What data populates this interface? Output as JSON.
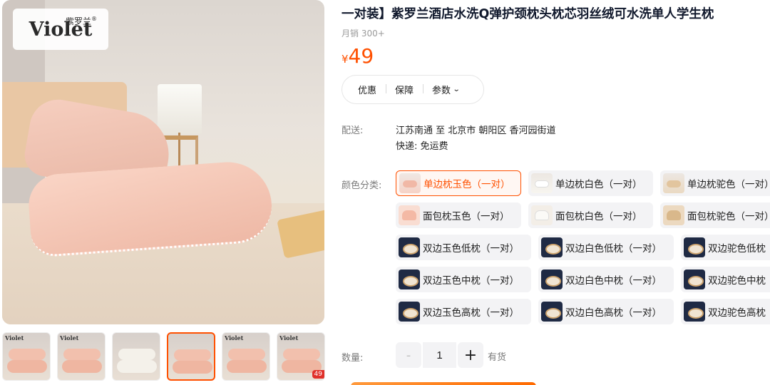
{
  "gallery": {
    "logo_word": "Violet",
    "logo_cn": "紫罗兰",
    "logo_mark": "®",
    "thumb_logo": "Violet",
    "thumb_badge": "49"
  },
  "product": {
    "title": "一对装】紫罗兰酒店水洗Q弹护颈枕头枕芯羽丝绒可水洗单人学生枕",
    "sales": "月销 300+",
    "currency": "¥",
    "price": "49"
  },
  "tabs": {
    "promo": "优惠",
    "guarantee": "保障",
    "params": "参数"
  },
  "shipping": {
    "label": "配送:",
    "route": "江苏南通 至 北京市 朝阳区 香河园街道",
    "delivery": "快递: 免运费"
  },
  "color": {
    "label": "颜色分类:",
    "options": [
      "单边枕玉色（一对）",
      "单边枕白色（一对）",
      "单边枕驼色（一对）",
      "面包枕玉色（一对）",
      "面包枕白色（一对）",
      "面包枕驼色（一对）",
      "双边玉色低枕（一对）",
      "双边白色低枕（一对）",
      "双边驼色低枕",
      "双边玉色中枕（一对）",
      "双边白色中枕（一对）",
      "双边驼色中枕",
      "双边玉色高枕（一对）",
      "双边白色高枕（一对）",
      "双边驼色高枕"
    ],
    "selected_index": 0
  },
  "quantity": {
    "label": "数量:",
    "minus": "-",
    "plus": "+",
    "value": "1",
    "stock": "有货"
  },
  "colors": {
    "accent": "#ff5000"
  }
}
